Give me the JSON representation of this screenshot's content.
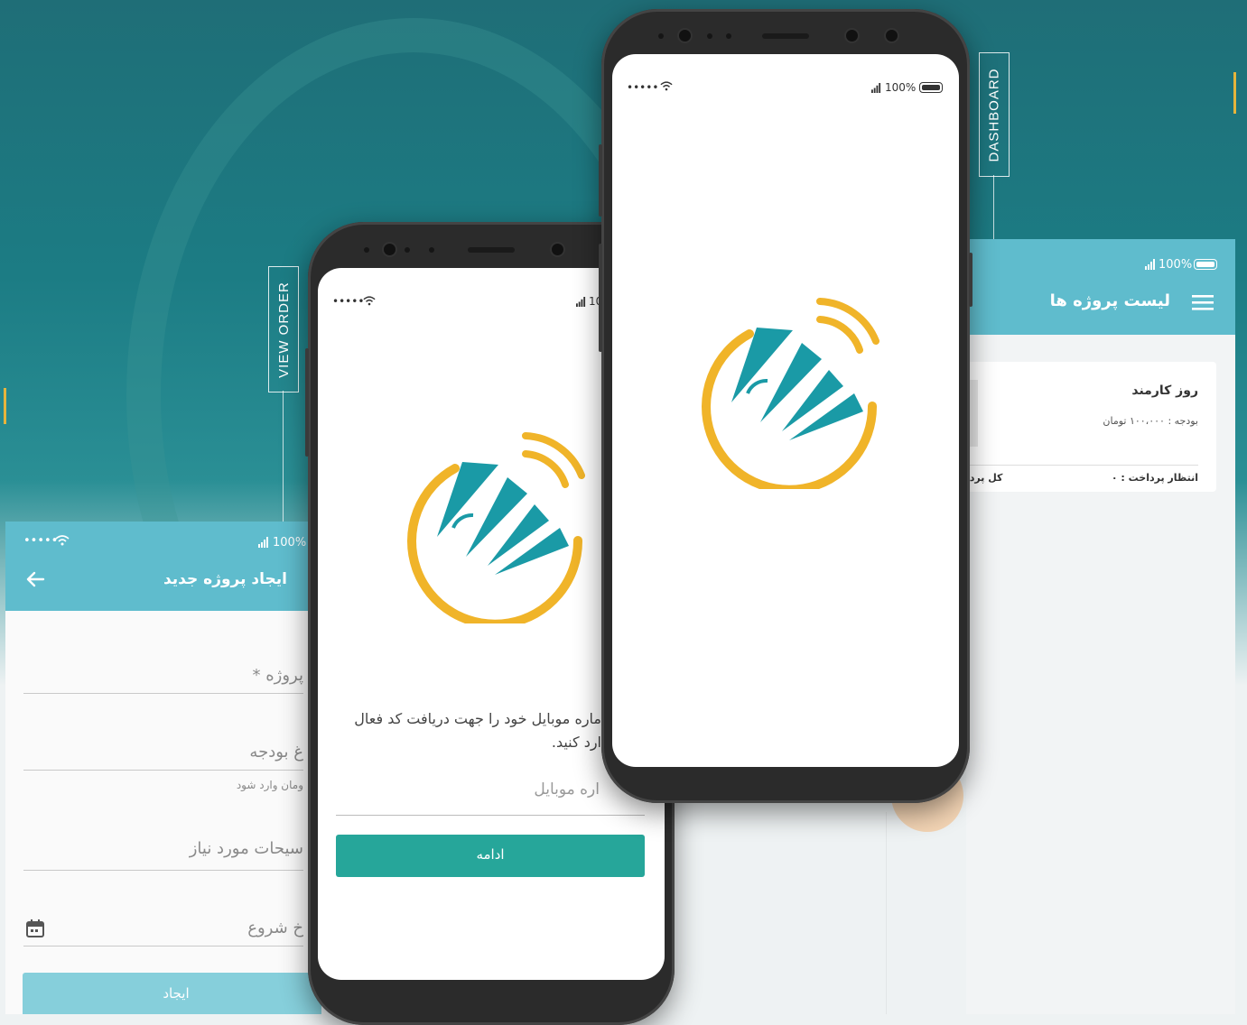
{
  "labels": {
    "view_order": "VIEW ORDER",
    "dashboard": "DASHBOARD"
  },
  "create_screen": {
    "status_dots": "•••••",
    "status_signal": "100%",
    "title": "ایجاد پروژه جدید",
    "fields": [
      {
        "placeholder": "پروژه *"
      },
      {
        "placeholder": "غ بودجه",
        "hint": "ومان وارد شود"
      },
      {
        "placeholder": "سیحات مورد نیاز"
      },
      {
        "placeholder": "خ شروع"
      }
    ],
    "submit_label": "ایجاد"
  },
  "login_phone": {
    "status_dots": "•••••",
    "status_signal": "10",
    "instruction_line1": "ماره موبایل خود را جهت دریافت کد فعال",
    "instruction_line2": "ارد کنید.",
    "mobile_placeholder": "اره موبایل",
    "continue_label": "ادامه"
  },
  "splash_phone": {
    "status_dots": "•••••",
    "status_signal": "100%"
  },
  "dashboard_screen": {
    "status_signal": "100%",
    "title": "لیست پروژه ها",
    "card": {
      "name": "روز کارمند",
      "budget": "بودجه : ۱۰۰،۰۰۰ تومان",
      "pending": "انتظار پرداخت : ۰",
      "total": "کل پردا"
    }
  },
  "colors": {
    "appbar": "#5fbccd",
    "teal_button": "#26a69a",
    "logo_orange": "#f0b429",
    "logo_teal": "#1a9aa6",
    "accent": "#e6b43c"
  }
}
